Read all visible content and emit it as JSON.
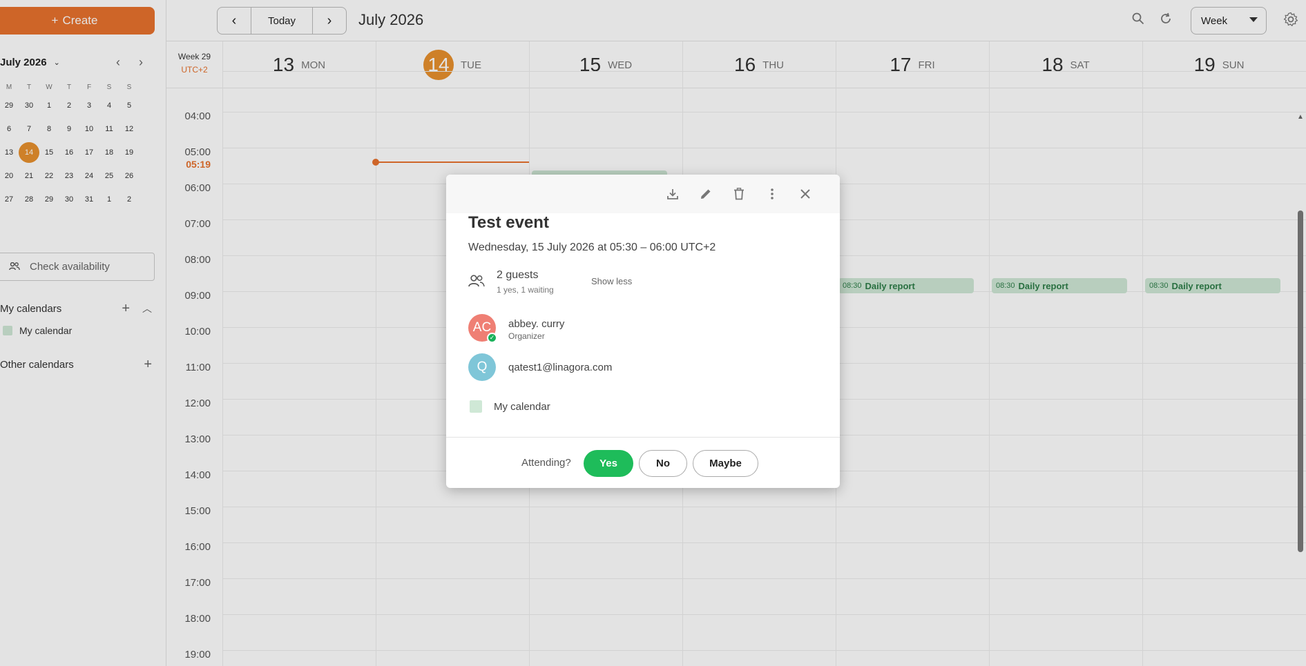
{
  "sidebar": {
    "create_label": "Create",
    "mini_calendar": {
      "month_label": "July 2026",
      "weekdays": [
        "M",
        "T",
        "W",
        "T",
        "F",
        "S",
        "S"
      ],
      "weeks": [
        [
          "29",
          "30",
          "1",
          "2",
          "3",
          "4",
          "5"
        ],
        [
          "6",
          "7",
          "8",
          "9",
          "10",
          "11",
          "12"
        ],
        [
          "13",
          "14",
          "15",
          "16",
          "17",
          "18",
          "19"
        ],
        [
          "20",
          "21",
          "22",
          "23",
          "24",
          "25",
          "26"
        ],
        [
          "27",
          "28",
          "29",
          "30",
          "31",
          "1",
          "2"
        ]
      ],
      "today": "14"
    },
    "check_availability": "Check availability",
    "my_calendars_label": "My calendars",
    "my_calendar_item": "My calendar",
    "other_calendars_label": "Other calendars"
  },
  "toolbar": {
    "today_label": "Today",
    "current_period": "July 2026",
    "view_label": "Week"
  },
  "week": {
    "week_label": "Week 29",
    "timezone": "UTC+2",
    "days": [
      {
        "num": "13",
        "name": "MON"
      },
      {
        "num": "14",
        "name": "TUE"
      },
      {
        "num": "15",
        "name": "WED"
      },
      {
        "num": "16",
        "name": "THU"
      },
      {
        "num": "17",
        "name": "FRI"
      },
      {
        "num": "18",
        "name": "SAT"
      },
      {
        "num": "19",
        "name": "SUN"
      }
    ],
    "today_index": 1,
    "hours": [
      "04:00",
      "05:00",
      "06:00",
      "07:00",
      "08:00",
      "09:00",
      "10:00",
      "11:00",
      "12:00",
      "13:00",
      "14:00",
      "15:00",
      "16:00",
      "17:00",
      "18:00",
      "19:00"
    ],
    "now_label": "05:19",
    "events": [
      {
        "time": "08:30",
        "name": "Daily report"
      },
      {
        "time": "08:30",
        "name": "Daily report"
      },
      {
        "time": "08:30",
        "name": "Daily report"
      }
    ]
  },
  "event_dialog": {
    "title": "Test event",
    "datetime": "Wednesday, 15 July 2026 at 05:30 – 06:00 UTC+2",
    "guests_count": "2 guests",
    "guests_summary": "1 yes, 1 waiting",
    "show_less": "Show less",
    "attendees": [
      {
        "initials": "AC",
        "name": "abbey. curry",
        "role": "Organizer"
      },
      {
        "initials": "Q",
        "name": "qatest1@linagora.com"
      }
    ],
    "calendar": "My calendar",
    "attending_label": "Attending?",
    "yes_label": "Yes",
    "no_label": "No",
    "maybe_label": "Maybe"
  },
  "colors": {
    "accent": "#e8722e",
    "today": "#e8902e",
    "event_bg": "#cfe8d6",
    "event_text": "#2e7d48",
    "yes": "#1ebc5a"
  }
}
